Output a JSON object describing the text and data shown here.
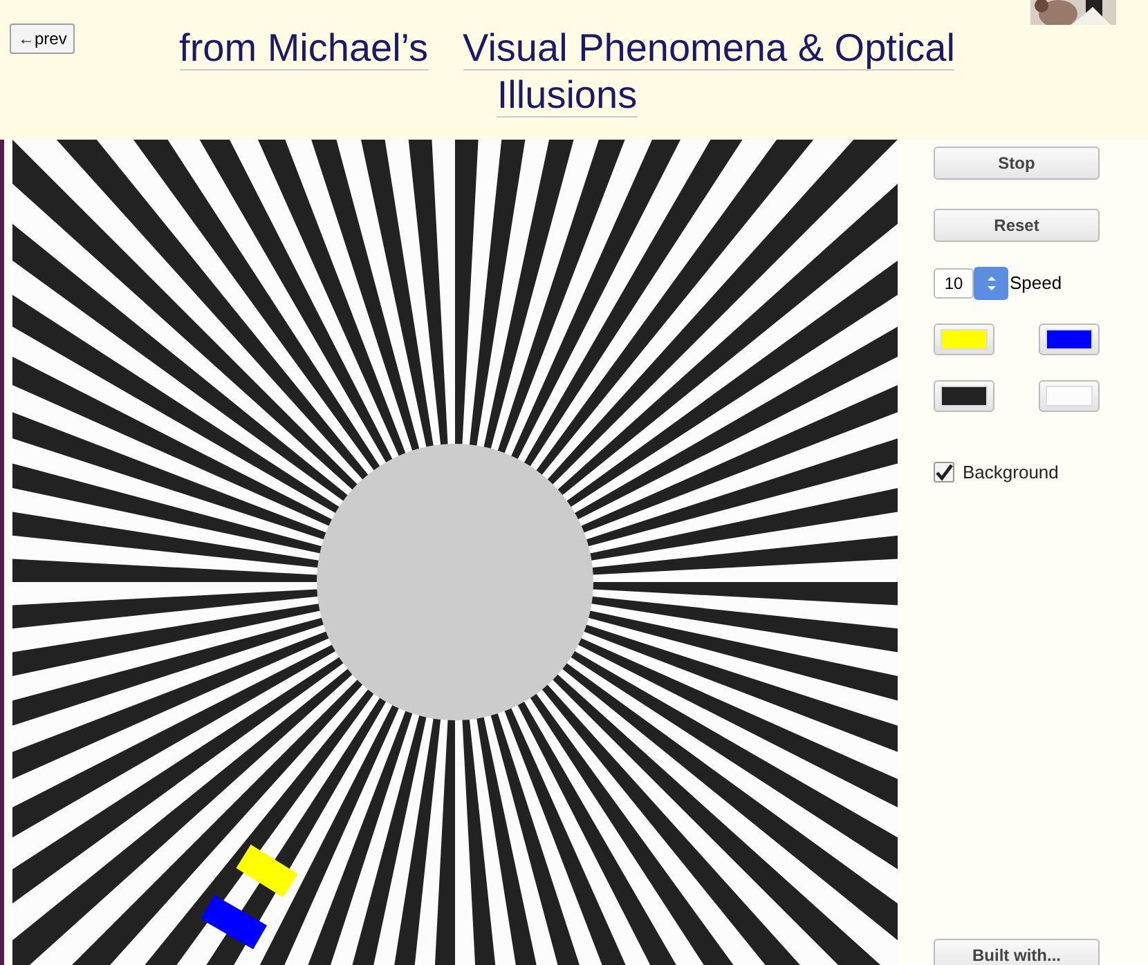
{
  "prev_button": {
    "label": "←prev"
  },
  "title_links": [
    "from Michael’s",
    "Visual Phenomena & Optical",
    "Illusions"
  ],
  "controls": {
    "stop_button": "Stop",
    "reset_button": "Reset",
    "speed": {
      "value": "10",
      "label": "Speed"
    },
    "swatches": [
      {
        "color": "#ffff00"
      },
      {
        "color": "#0000ff"
      },
      {
        "color": "#222222"
      },
      {
        "color": "#fcfcfc"
      }
    ],
    "background": {
      "label": "Background",
      "checked": true
    },
    "built_with_button": "Built with..."
  }
}
